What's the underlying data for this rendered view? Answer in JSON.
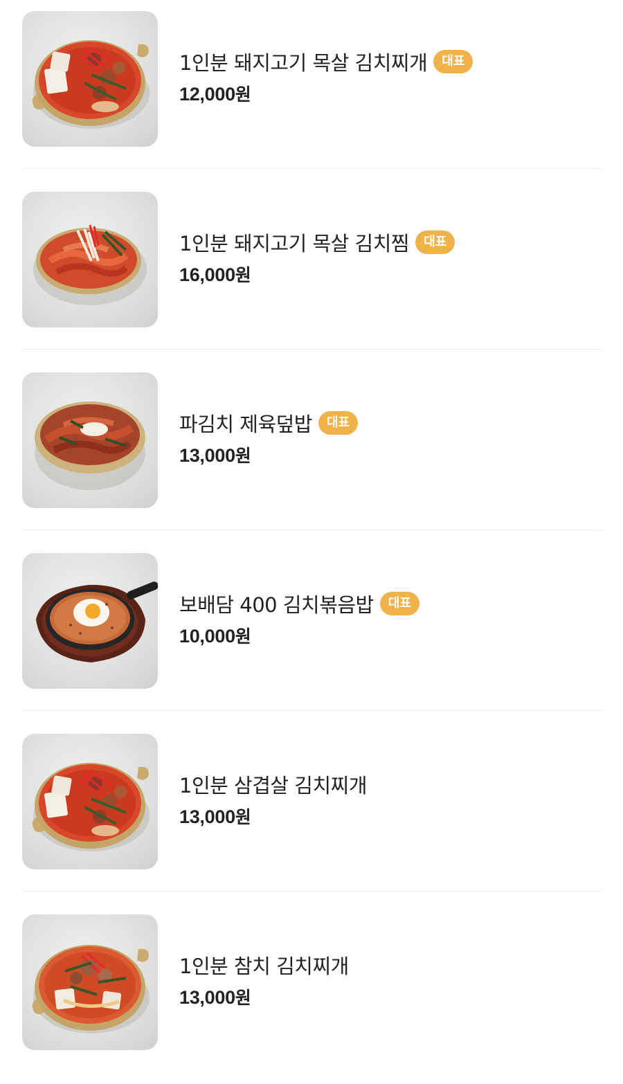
{
  "menu": {
    "items": [
      {
        "name": "1인분 돼지고기 목살 김치찌개",
        "badge": "대표",
        "price": "12,000",
        "currency": "원",
        "image": "kimchi-stew-pot"
      },
      {
        "name": "1인분 돼지고기 목살 김치찜",
        "badge": "대표",
        "price": "16,000",
        "currency": "원",
        "image": "braised-kimchi-plate"
      },
      {
        "name": "파김치 제육덮밥",
        "badge": "대표",
        "price": "13,000",
        "currency": "원",
        "image": "spicy-pork-rice-bowl"
      },
      {
        "name": "보배담 400 김치볶음밥",
        "badge": "대표",
        "price": "10,000",
        "currency": "원",
        "image": "kimchi-fried-rice-skillet"
      },
      {
        "name": "1인분 삼겹살 김치찌개",
        "badge": "",
        "price": "13,000",
        "currency": "원",
        "image": "kimchi-stew-pot"
      },
      {
        "name": "1인분 참치 김치찌개",
        "badge": "",
        "price": "13,000",
        "currency": "원",
        "image": "tuna-kimchi-stew-pot"
      }
    ]
  },
  "colors": {
    "badge_bg": "#f0b24a",
    "text": "#222222",
    "divider": "#ececec"
  }
}
